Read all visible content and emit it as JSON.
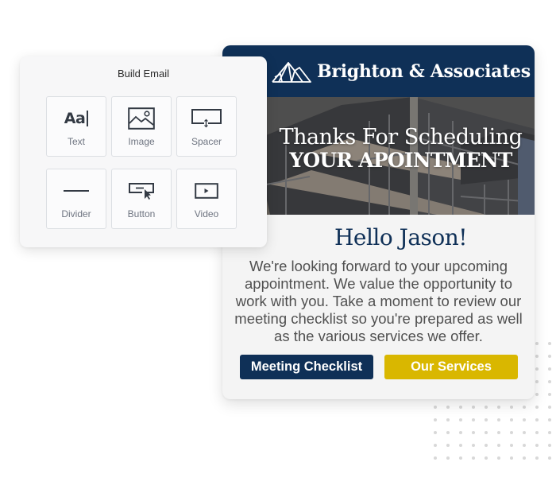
{
  "builder": {
    "title": "Build Email",
    "blocks": [
      {
        "label": "Text",
        "icon": "text-icon"
      },
      {
        "label": "Image",
        "icon": "image-icon"
      },
      {
        "label": "Spacer",
        "icon": "spacer-icon"
      },
      {
        "label": "Divider",
        "icon": "divider-icon"
      },
      {
        "label": "Button",
        "icon": "button-icon"
      },
      {
        "label": "Video",
        "icon": "video-icon"
      }
    ],
    "text_glyph": "Aa"
  },
  "email": {
    "brand": {
      "name": "Brighton & Associates",
      "logo_icon": "mountain-logo-icon"
    },
    "hero": {
      "line1": "Thanks For Scheduling",
      "line2": "YOUR APOINTMENT"
    },
    "greeting": "Hello Jason!",
    "body": "We're looking forward to your upcoming appointment. We value the opportunity to work with you. Take a moment to review our meeting checklist so you're prepared as well as the various services we offer.",
    "buttons": {
      "primary": "Meeting Checklist",
      "secondary": "Our Services"
    }
  },
  "colors": {
    "navy": "#0f3057",
    "gold": "#d9b700",
    "card_bg": "#f4f4f4",
    "builder_bg": "#f7f7f8",
    "body_text": "#505050",
    "tile_label": "#6e7480"
  }
}
